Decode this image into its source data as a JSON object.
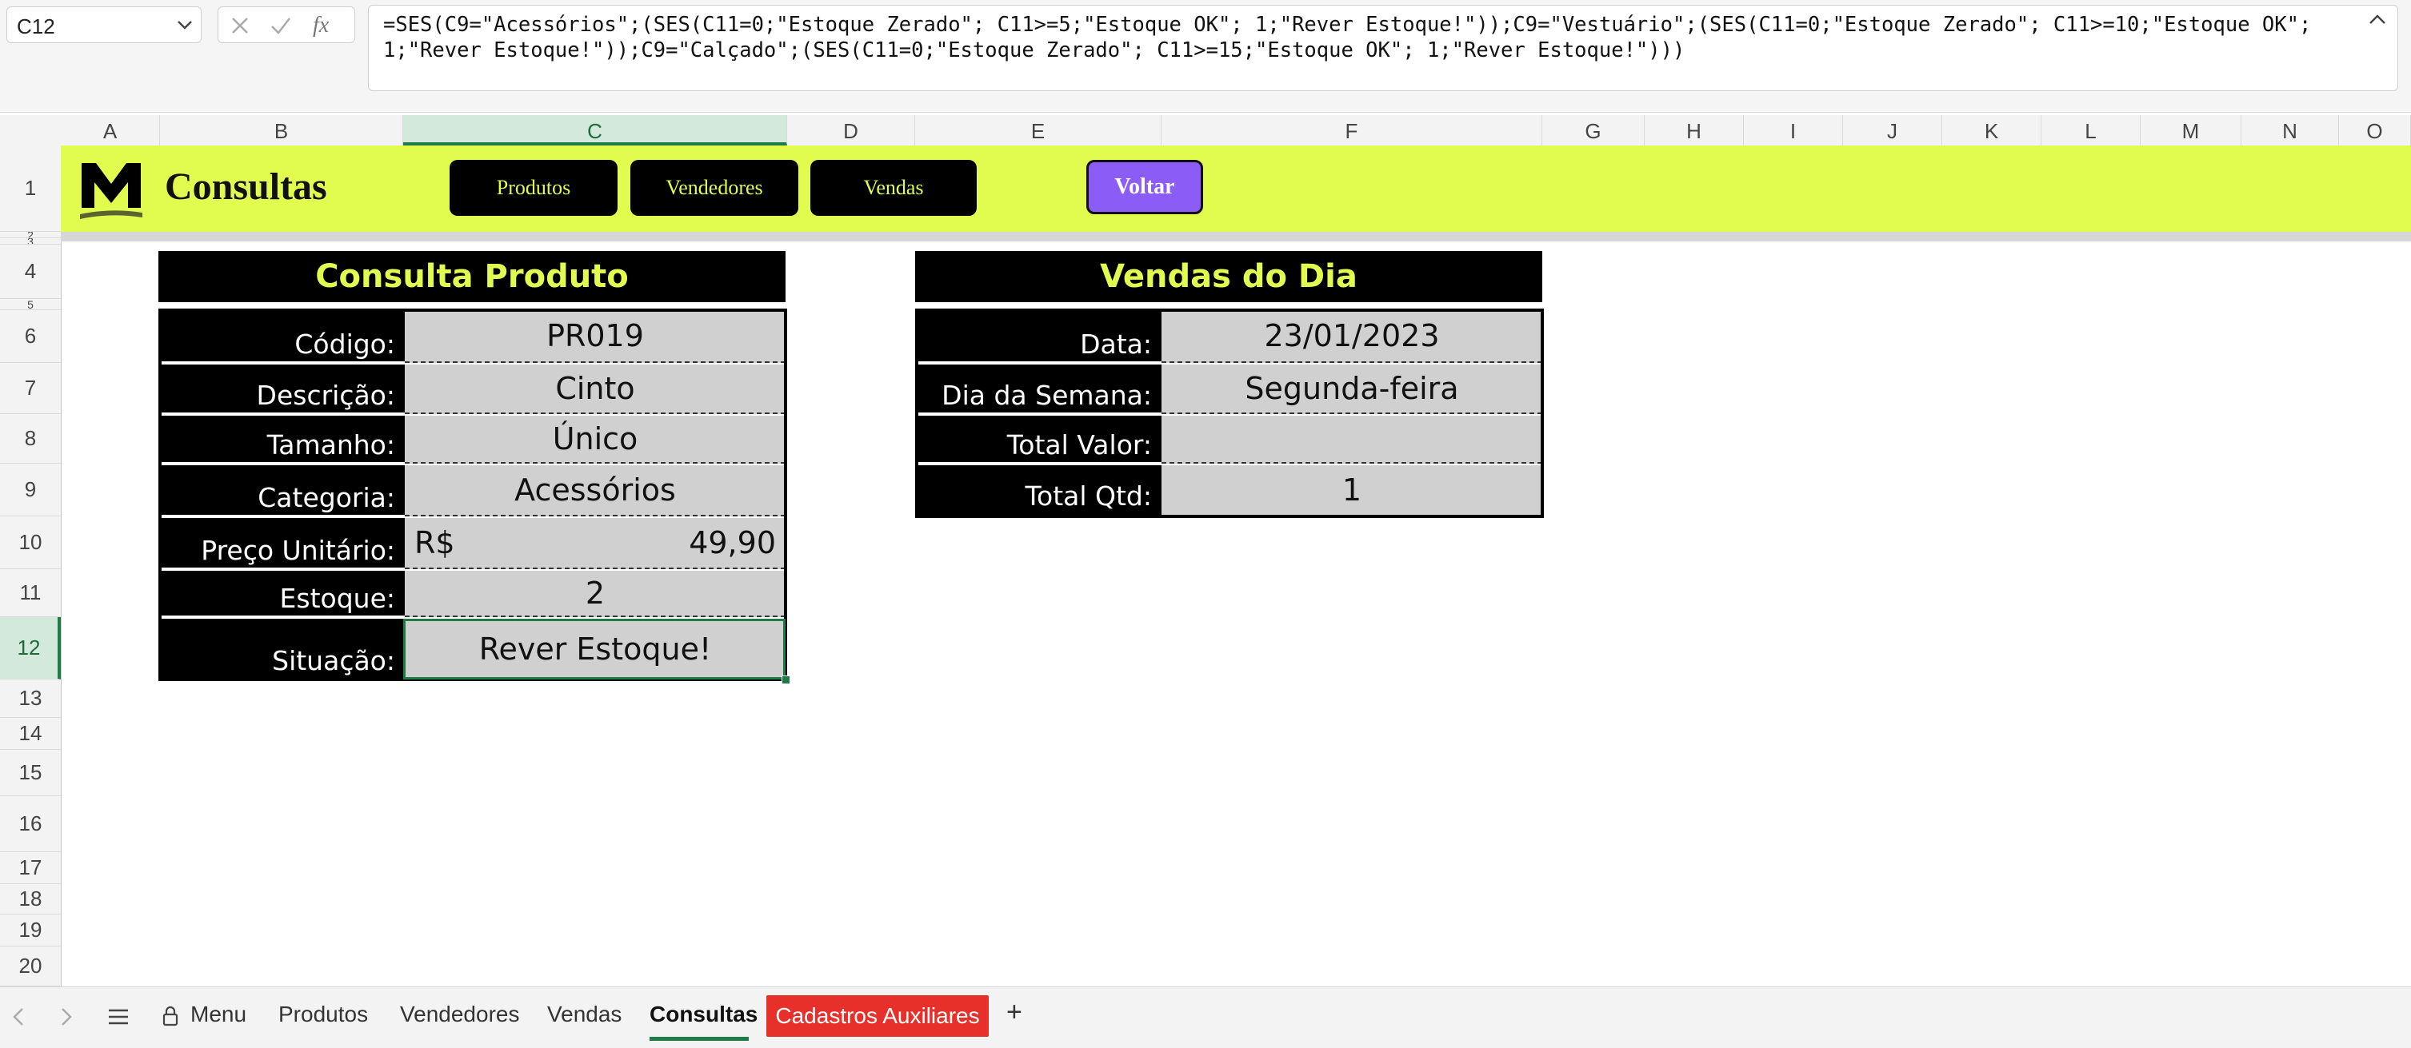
{
  "formula_bar": {
    "name_box": "C12",
    "fx_label": "fx",
    "formula": "=SES(C9=\"Acessórios\";(SES(C11=0;\"Estoque Zerado\"; C11>=5;\"Estoque OK\"; 1;\"Rever Estoque!\"));C9=\"Vestuário\";(SES(C11=0;\"Estoque Zerado\"; C11>=10;\"Estoque OK\"; 1;\"Rever Estoque!\"));C9=\"Calçado\";(SES(C11=0;\"Estoque Zerado\"; C11>=15;\"Estoque OK\"; 1;\"Rever Estoque!\")))"
  },
  "columns": [
    "A",
    "B",
    "C",
    "D",
    "E",
    "F",
    "G",
    "H",
    "I",
    "J",
    "K",
    "L",
    "M",
    "N",
    "O"
  ],
  "selected_column": "C",
  "rows": [
    "1",
    "2",
    "3",
    "4",
    "5",
    "6",
    "7",
    "8",
    "9",
    "10",
    "11",
    "12",
    "13",
    "14",
    "15",
    "16",
    "17",
    "18",
    "19",
    "20"
  ],
  "selected_row": "12",
  "banner": {
    "title": "Consultas",
    "nav_buttons": [
      "Produtos",
      "Vendedores",
      "Vendas"
    ],
    "back_button": "Voltar"
  },
  "consulta_produto": {
    "title": "Consulta Produto",
    "fields": [
      {
        "label": "Código:",
        "value": "PR019"
      },
      {
        "label": "Descrição:",
        "value": "Cinto"
      },
      {
        "label": "Tamanho:",
        "value": "Único"
      },
      {
        "label": "Categoria:",
        "value": "Acessórios"
      },
      {
        "label": "Preço Unitário:",
        "currency": "R$",
        "value": "49,90"
      },
      {
        "label": "Estoque:",
        "value": "2"
      },
      {
        "label": "Situação:",
        "value": "Rever Estoque!"
      }
    ]
  },
  "vendas_do_dia": {
    "title": "Vendas do Dia",
    "fields": [
      {
        "label": "Data:",
        "value": "23/01/2023"
      },
      {
        "label": "Dia da Semana:",
        "value": "Segunda-feira"
      },
      {
        "label": "Total Valor:",
        "value": ""
      },
      {
        "label": "Total Qtd:",
        "value": "1"
      }
    ]
  },
  "sheet_tabs": {
    "tabs": [
      "Menu",
      "Produtos",
      "Vendedores",
      "Vendas",
      "Consultas",
      "Cadastros Auxiliares"
    ],
    "active": "Consultas",
    "highlighted": "Cadastros Auxiliares",
    "highlight_color": "#e8302a",
    "add_label": "+"
  },
  "colors": {
    "banner": "#e1fc4f",
    "accent_text": "#e1fc4f",
    "back_button": "#8b5cf6",
    "selection": "#1e7b45"
  }
}
